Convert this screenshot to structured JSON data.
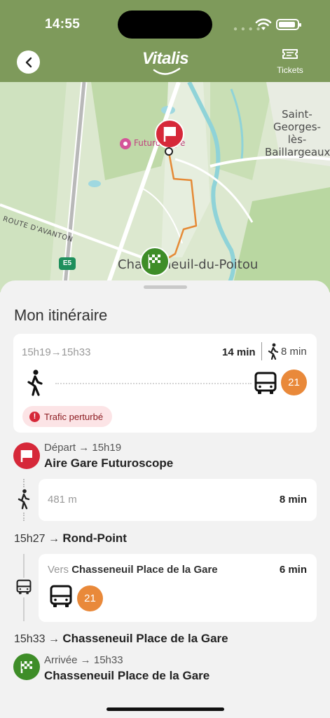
{
  "status_bar": {
    "time": "14:55"
  },
  "header": {
    "back_icon": "chevron-left-icon",
    "logo_text": "Vitalis",
    "tickets_label": "Tickets",
    "tickets_icon": "ticket-icon",
    "background_color": "#7e9a5b"
  },
  "map": {
    "labels": {
      "city": "Saint-Georges-lès-Baillargeaux",
      "road": "ROUTE D'AVANTON",
      "town": "Chasseneuil-du-Poitou",
      "poi": "Futuroscope",
      "highway_badge": "E5"
    },
    "start_marker_color": "#d62839",
    "end_marker_color": "#3e8d28",
    "route_color": "#e58a36"
  },
  "itinerary": {
    "title": "Mon itinéraire",
    "summary": {
      "times": "15h19→15h33",
      "duration": "14 min",
      "walk_time": "8 min",
      "line": "21",
      "line_color": "#e9893a",
      "traffic_alert": "Trafic perturbé"
    },
    "departure": {
      "label": "Départ → 15h19",
      "stop": "Aire Gare Futuroscope"
    },
    "walk_leg": {
      "distance": "481 m",
      "duration": "8 min"
    },
    "transfer": {
      "time": "15h27 →",
      "stop": "Rond-Point"
    },
    "bus_leg": {
      "direction_prefix": "Vers",
      "direction": "Chasseneuil Place de la Gare",
      "duration": "6 min",
      "line": "21"
    },
    "arrival_stop_line": {
      "time": "15h33 →",
      "stop": "Chasseneuil Place de la Gare"
    },
    "arrival": {
      "label": "Arrivée → 15h33",
      "stop": "Chasseneuil Place de la Gare"
    }
  }
}
